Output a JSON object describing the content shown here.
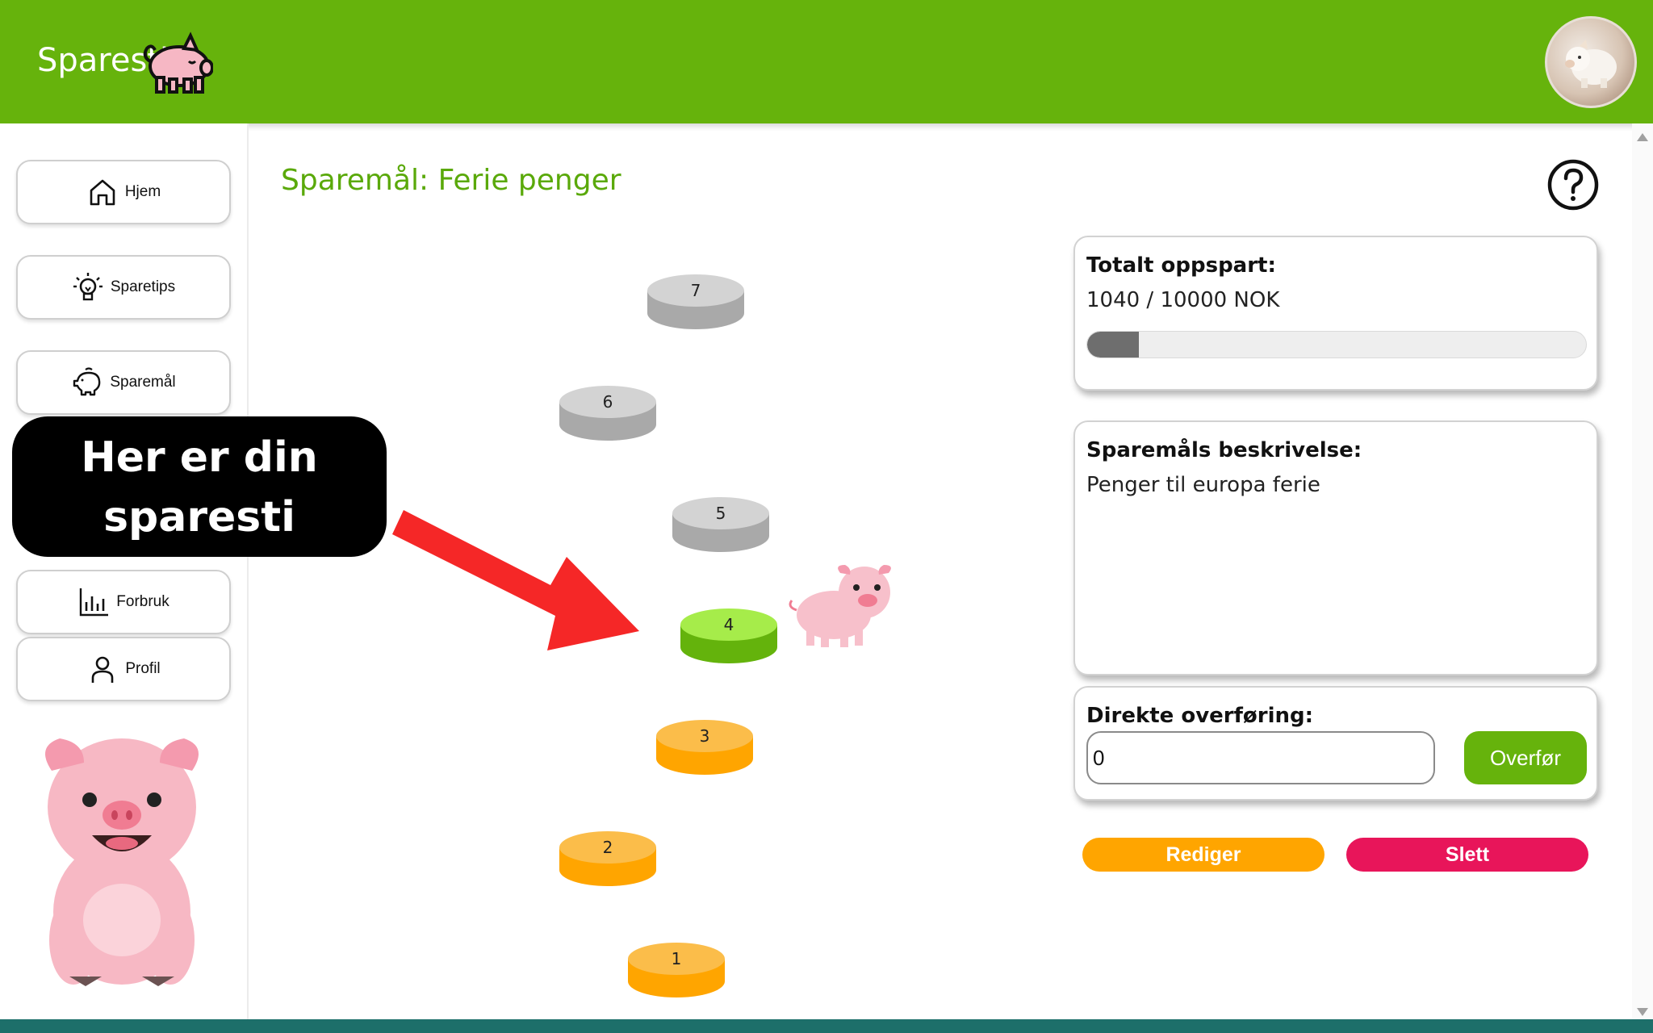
{
  "header": {
    "brand": "Sparesti",
    "brand_icon": "pig-icon",
    "avatar_icon": "piggy-bank-avatar"
  },
  "sidebar": {
    "items": [
      {
        "label": "Hjem",
        "icon": "home-icon"
      },
      {
        "label": "Sparetips",
        "icon": "lightbulb-icon"
      },
      {
        "label": "Sparemål",
        "icon": "piggy-bank-icon"
      },
      {
        "label": "Forbruk",
        "icon": "bar-chart-icon"
      },
      {
        "label": "Profil",
        "icon": "user-icon"
      }
    ]
  },
  "main": {
    "title": "Sparemål: Ferie penger",
    "help_icon": "help-icon"
  },
  "path": {
    "steps": [
      {
        "number": "7",
        "status": "locked"
      },
      {
        "number": "6",
        "status": "locked"
      },
      {
        "number": "5",
        "status": "locked"
      },
      {
        "number": "4",
        "status": "current"
      },
      {
        "number": "3",
        "status": "completed"
      },
      {
        "number": "2",
        "status": "completed"
      },
      {
        "number": "1",
        "status": "completed"
      }
    ],
    "colors": {
      "locked_top": "#d3d3d3",
      "locked_side": "#a9a9a9",
      "current_top": "#a6ec4a",
      "current_side": "#64b30c",
      "completed_top": "#fbbd4a",
      "completed_side": "#ffa500"
    }
  },
  "tooltip": {
    "line1": "Her er din",
    "line2": "sparesti"
  },
  "total_card": {
    "title": "Totalt oppspart:",
    "value": "1040 / 10000 NOK",
    "progress_fraction": 0.104
  },
  "description_card": {
    "title": "Sparemåls beskrivelse:",
    "text": "Penger til europa ferie"
  },
  "transfer_card": {
    "title": "Direkte overføring:",
    "input_value": "0",
    "button_label": "Overfør"
  },
  "actions": {
    "edit_label": "Rediger",
    "delete_label": "Slett"
  },
  "colors": {
    "brand_green": "#66b30c",
    "title_green": "#5aa90a",
    "edit_orange": "#ffa500",
    "delete_pink": "#e8155a"
  }
}
